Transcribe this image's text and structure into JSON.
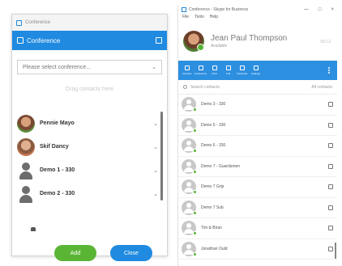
{
  "conference": {
    "title": "Conference",
    "header": "Conference",
    "select_placeholder": "Please select conference...",
    "drop_hint": "Drag contacts here",
    "participants": [
      {
        "name": "Pennie Mayo",
        "avatar": "photo1"
      },
      {
        "name": "Skif Dancy",
        "avatar": "photo2"
      },
      {
        "name": "Demo 1 - 330",
        "avatar": "silhouette"
      },
      {
        "name": "Demo 2 - 330",
        "avatar": "silhouette"
      }
    ],
    "add_label": "Add",
    "close_label": "Close",
    "accent": "#1f8ae0",
    "add_color": "#5bb535"
  },
  "main": {
    "title": "Conference - Skype for Business",
    "menu": [
      "File",
      "Tools",
      "Help"
    ],
    "window_controls": [
      "—",
      "□",
      "×"
    ],
    "profile": {
      "name": "Jean Paul Thompson",
      "status": "Available",
      "right": "00:12"
    },
    "toolbar": [
      "Contacts",
      "Conference",
      "Chat",
      "Call",
      "Voicemail",
      "Settings"
    ],
    "search_placeholder": "Search contacts",
    "filter": "All contacts",
    "contacts": [
      "Demo 3 - 330",
      "Demo 5 - 330",
      "Demo 6 - 330",
      "Demo 7 - Guardsmen",
      "Demo 7 Grip",
      "Demo 7 Sub",
      "Tim & Brian",
      "Jonathan Ould"
    ]
  }
}
